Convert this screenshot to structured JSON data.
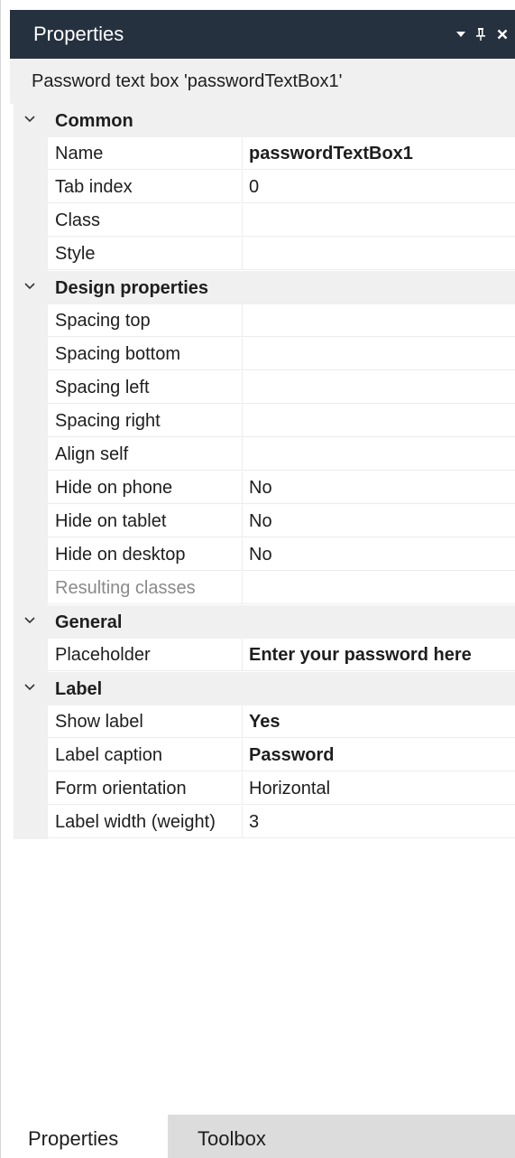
{
  "panel": {
    "title": "Properties",
    "subject": "Password text box 'passwordTextBox1'"
  },
  "categories": [
    {
      "label": "Common",
      "rows": [
        {
          "name": "Name",
          "value": "passwordTextBox1",
          "bold": true
        },
        {
          "name": "Tab index",
          "value": "0"
        },
        {
          "name": "Class",
          "value": ""
        },
        {
          "name": "Style",
          "value": ""
        }
      ]
    },
    {
      "label": "Design properties",
      "rows": [
        {
          "name": "Spacing top",
          "value": ""
        },
        {
          "name": "Spacing bottom",
          "value": ""
        },
        {
          "name": "Spacing left",
          "value": ""
        },
        {
          "name": "Spacing right",
          "value": ""
        },
        {
          "name": "Align self",
          "value": ""
        },
        {
          "name": "Hide on phone",
          "value": "No"
        },
        {
          "name": "Hide on tablet",
          "value": "No"
        },
        {
          "name": "Hide on desktop",
          "value": "No"
        },
        {
          "name": "Resulting classes",
          "value": "",
          "disabled": true
        }
      ]
    },
    {
      "label": "General",
      "rows": [
        {
          "name": "Placeholder",
          "value": "Enter your password here",
          "bold": true
        }
      ]
    },
    {
      "label": "Label",
      "rows": [
        {
          "name": "Show label",
          "value": "Yes",
          "bold": true
        },
        {
          "name": "Label caption",
          "value": "Password",
          "bold": true
        },
        {
          "name": "Form orientation",
          "value": "Horizontal"
        },
        {
          "name": "Label width (weight)",
          "value": "3"
        }
      ]
    }
  ],
  "tabs": {
    "properties": "Properties",
    "toolbox": "Toolbox"
  },
  "icons": {
    "dropdown": "chevron-down-icon",
    "pin": "pin-icon",
    "close": "close-icon",
    "collapse": "collapse-chevron-icon"
  },
  "colors": {
    "titlebar": "#26313f",
    "category_bg": "#f0f0f0",
    "inactive_tab": "#dcdcdc"
  }
}
